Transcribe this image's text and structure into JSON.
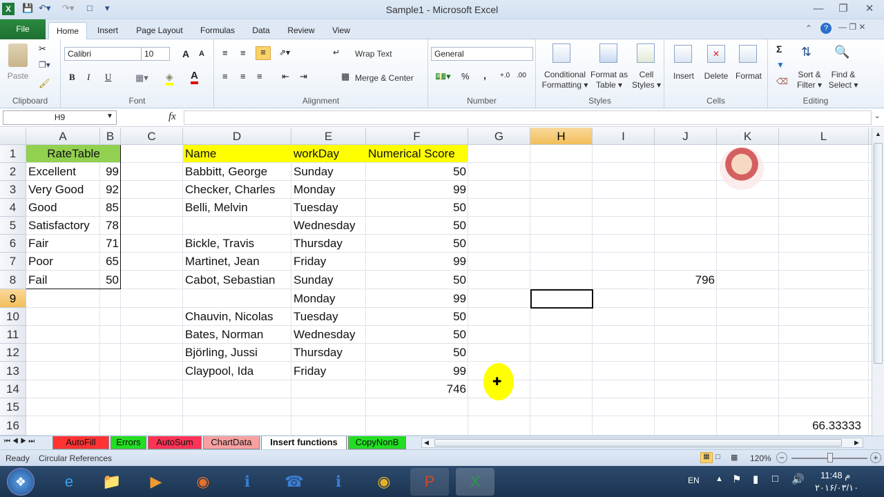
{
  "window": {
    "title": "Sample1 - Microsoft Excel"
  },
  "tabs": [
    "File",
    "Home",
    "Insert",
    "Page Layout",
    "Formulas",
    "Data",
    "Review",
    "View"
  ],
  "ribbon": {
    "clipboard": {
      "label": "Clipboard",
      "paste": "Paste"
    },
    "font": {
      "label": "Font",
      "name": "Calibri",
      "size": "10",
      "bold": "B",
      "italic": "I",
      "underline": "U",
      "grow": "A",
      "shrink": "A"
    },
    "alignment": {
      "label": "Alignment",
      "wrap": "Wrap Text",
      "merge": "Merge & Center"
    },
    "number": {
      "label": "Number",
      "format": "General",
      "percent": "%",
      "comma": ","
    },
    "styles": {
      "label": "Styles",
      "cond1": "Conditional",
      "cond2": "Formatting",
      "fmt1": "Format as",
      "fmt2": "Table",
      "cell1": "Cell",
      "cell2": "Styles"
    },
    "cells": {
      "label": "Cells",
      "insert": "Insert",
      "delete": "Delete",
      "format": "Format"
    },
    "editing": {
      "label": "Editing",
      "sort1": "Sort &",
      "sort2": "Filter",
      "find1": "Find &",
      "find2": "Select",
      "sigma": "Σ"
    }
  },
  "formula": {
    "namebox": "H9",
    "fx": "fx",
    "value": ""
  },
  "columns": [
    "A",
    "B",
    "C",
    "D",
    "E",
    "F",
    "G",
    "H",
    "I",
    "J",
    "K",
    "L"
  ],
  "rows": [
    "1",
    "2",
    "3",
    "4",
    "5",
    "6",
    "7",
    "8",
    "9",
    "10",
    "11",
    "12",
    "13",
    "14",
    "15",
    "16"
  ],
  "cells": {
    "A1": "RateTable",
    "A2": "Excellent",
    "B2": "99",
    "A3": "Very Good",
    "B3": "92",
    "A4": "Good",
    "B4": "85",
    "A5": "Satisfactory",
    "B5": "78",
    "A6": "Fair",
    "B6": "71",
    "A7": "Poor",
    "B7": "65",
    "A8": "Fail",
    "B8": "50",
    "D1": "Name",
    "E1": "workDay",
    "F1": "Numerical Score",
    "D2": "Babbitt, George",
    "E2": "Sunday",
    "F2": "50",
    "D3": "Checker, Charles",
    "E3": "Monday",
    "F3": "99",
    "D4": "Belli, Melvin",
    "E4": "Tuesday",
    "F4": "50",
    "D5": "",
    "E5": "Wednesday",
    "F5": "50",
    "D6": "Bickle, Travis",
    "E6": "Thursday",
    "F6": "50",
    "D7": "Martinet, Jean",
    "E7": "Friday",
    "F7": "99",
    "D8": "Cabot, Sebastian",
    "E8": "Sunday",
    "F8": "50",
    "D9": "",
    "E9": "Monday",
    "F9": "99",
    "D10": "Chauvin, Nicolas",
    "E10": "Tuesday",
    "F10": "50",
    "D11": "Bates, Norman",
    "E11": "Wednesday",
    "F11": "50",
    "D12": "Björling, Jussi",
    "E12": "Thursday",
    "F12": "50",
    "D13": "Claypool, Ida",
    "E13": "Friday",
    "F13": "99",
    "F14": "746",
    "J8": "796",
    "L16": "66.33333"
  },
  "sheets": [
    {
      "name": "AutoFill",
      "color": "#ff3333"
    },
    {
      "name": "Errors",
      "color": "#22dd22"
    },
    {
      "name": "AutoSum",
      "color": "#ff3355"
    },
    {
      "name": "ChartData",
      "color": "#f8a0a0"
    },
    {
      "name": "Insert functions",
      "color": "#ffffff"
    },
    {
      "name": "CopyNonB",
      "color": "#22dd22"
    }
  ],
  "status": {
    "ready": "Ready",
    "circular": "Circular References",
    "zoom": "120%"
  },
  "taskbar": {
    "lang": "EN",
    "time": "11:48 م",
    "date": "۲۰۱۶/۰۳/۱۰"
  },
  "colors": {
    "header_fill": "#ffff00",
    "ratetable_fill": "#92d050",
    "selection": "#f2be5a"
  }
}
